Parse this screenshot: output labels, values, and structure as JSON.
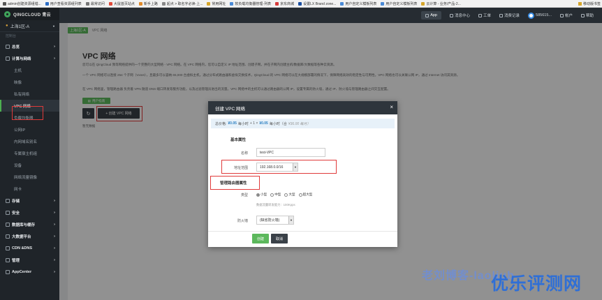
{
  "bookmarks": [
    {
      "label": "admin创建资源组错...",
      "color": "#555"
    },
    {
      "label": "用户查看资源组列表",
      "color": "#2b6cc4"
    },
    {
      "label": "最常访问",
      "color": "#777"
    },
    {
      "label": "大鼠首页站点",
      "color": "#e04a3a"
    },
    {
      "label": "新手上路",
      "color": "#e08a2a"
    },
    {
      "label": "起点 > 取名字必读-上...",
      "color": "#888"
    },
    {
      "label": "常用网址",
      "color": "#d6a62b"
    },
    {
      "label": "软负载均衡器管理-列表",
      "color": "#4a8ad6"
    },
    {
      "label": "京东商城",
      "color": "#d63a3a"
    },
    {
      "label": "设置LX Brand zone...",
      "color": "#1a4fa0"
    },
    {
      "label": "用户自定义模板列表",
      "color": "#4a8ad6"
    },
    {
      "label": "用户自定义模板列表",
      "color": "#4a8ad6"
    },
    {
      "label": "云计算 - 业务/产品-2...",
      "color": "#d6a62b"
    }
  ],
  "bookmarks_more": "移动版书签",
  "brand": "QINGCLOUD 青云",
  "region": "上海1区-A",
  "sidebar": {
    "section_label": "控制台",
    "items": [
      {
        "label": "总览",
        "type": "group"
      },
      {
        "label": "计算与网络",
        "type": "group"
      },
      {
        "label": "主机",
        "type": "sub"
      },
      {
        "label": "映像",
        "type": "sub"
      },
      {
        "label": "私有网络",
        "type": "sub"
      },
      {
        "label": "VPC 网络",
        "type": "sub-active"
      },
      {
        "label": "负载均衡器",
        "type": "sub"
      },
      {
        "label": "公网IP",
        "type": "sub"
      },
      {
        "label": "内网域名别名",
        "type": "sub"
      },
      {
        "label": "专属宿主机组",
        "type": "sub"
      },
      {
        "label": "设备",
        "type": "sub"
      },
      {
        "label": "网络流量镜像",
        "type": "sub"
      },
      {
        "label": "网卡",
        "type": "sub"
      },
      {
        "label": "存储",
        "type": "group"
      },
      {
        "label": "安全",
        "type": "group"
      },
      {
        "label": "数据库与缓存",
        "type": "group"
      },
      {
        "label": "大数据平台",
        "type": "group"
      },
      {
        "label": "CDN &DNS",
        "type": "group"
      },
      {
        "label": "管理",
        "type": "group"
      },
      {
        "label": "AppCenter",
        "type": "group"
      }
    ]
  },
  "topbar": {
    "app": "App",
    "messages": "消息中心",
    "tickets": "工单",
    "billing": "消费记录",
    "user": "585615...",
    "account": "帐户",
    "help": "帮助"
  },
  "main": {
    "breadcrumb_tag": "上海1区-A",
    "breadcrumb_current": "VPC 网络",
    "title": "VPC 网络",
    "desc1": "您可以在 QingCloud 我等网络提供的一个完整的大型网络 - VPC 网络。在 VPC 网络内，您可以自定义 IP 地址范围、创建子网，并在子网内创建主机/数据库/大数据等各种云资源。",
    "desc2": "一个 VPC 网络可以连接 254 个子网（Vxnet），且最多可以容纳 65,000 台虚拟主机。通过分布式路由器和虚拟交换技术，QingCloud 的 VPC 网络可以在大规模部署的情况下，保障网络高效的稳定性与可用性。VPC 网络也可以关联公网 IP，通过 Internet 访问其资源。",
    "desc3": "在 VPC 网络里，管理路由器 ​负责着 VPN 隧道 DNS 端口转发等服务功能，以及过滤管理员进出的流量。VPC 网络中的主机可以通过路由器的公网 IP，设置专属的防火墙，通过 IP、防火墙与管理路由器之间交互配置。",
    "docs_button": "用户指南",
    "refresh_icon": "refresh-icon",
    "create_button": "+ 创建 VPC 网络",
    "empty_note": "暂无数据"
  },
  "modal": {
    "title": "创建 VPC 网络",
    "close": "×",
    "price_label": "总价格:",
    "price_value": "¥0.05",
    "price_unit1": "每小时",
    "price_plus": "+ 1 ×",
    "price_value2": "¥0.05",
    "price_unit2": "每小时（合",
    "price_month": "¥36.00 每月）",
    "basic_section": "基本属性",
    "name_label": "名称",
    "name_value": "test-VPC",
    "range_label": "地址范围",
    "range_value": "192.168.0.0/16",
    "router_section": "管理路由器属性",
    "type_label": "类型",
    "types": [
      {
        "label": "小型",
        "checked": true
      },
      {
        "label": "中型",
        "checked": false
      },
      {
        "label": "大型",
        "checked": false
      },
      {
        "label": "超大型",
        "checked": false
      }
    ],
    "type_hint": "数据流量转发能力：100Kpps",
    "firewall_label": "防火墙",
    "firewall_value": "(缺省防火墙)",
    "create_label": "创建",
    "cancel_label": "取消"
  },
  "watermark": {
    "line1": "老刘博客-laoliub",
    "line2": "优乐评测网"
  },
  "colors": {
    "accent": "#5cb85c",
    "highlight": "#e03a3a",
    "sidebar_bg": "#1f2429",
    "modal_head": "#2e353c"
  }
}
